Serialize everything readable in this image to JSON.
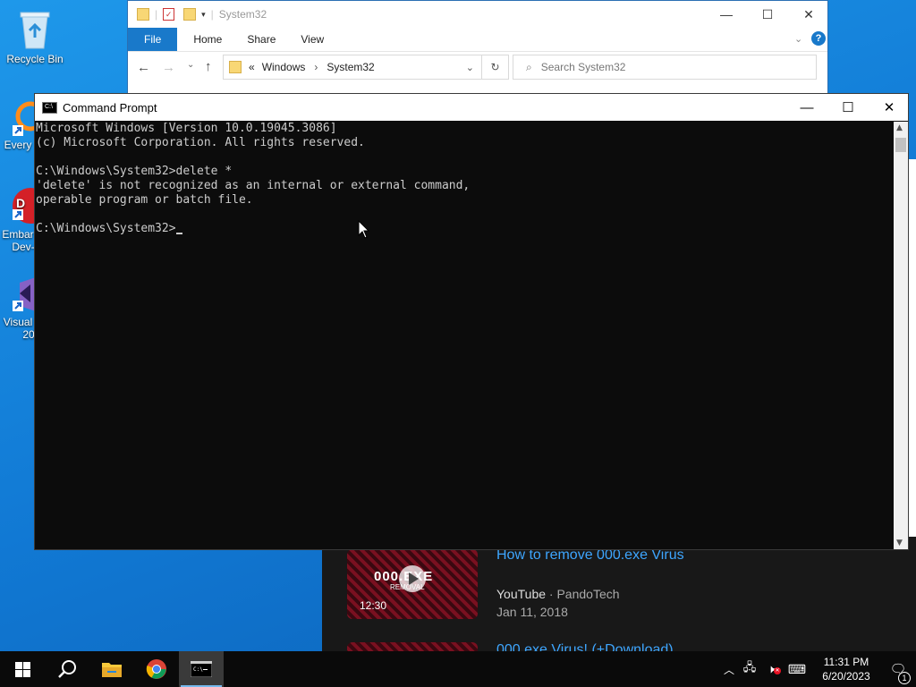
{
  "desktop": {
    "icons": [
      {
        "label": "Recycle Bin"
      },
      {
        "label": "Every"
      },
      {
        "label": "Embar"
      },
      {
        "label": "Dev-"
      },
      {
        "label": "Visual"
      },
      {
        "label": "20"
      }
    ]
  },
  "explorer": {
    "title": "System32",
    "ribbon_tabs": [
      "File",
      "Home",
      "Share",
      "View"
    ],
    "breadcrumb": [
      "Windows",
      "System32"
    ],
    "breadcrumb_prefix": "«",
    "search_placeholder": "Search System32"
  },
  "cmd": {
    "title": "Command Prompt",
    "lines": [
      "Microsoft Windows [Version 10.0.19045.3086]",
      "(c) Microsoft Corporation. All rights reserved.",
      "",
      "C:\\Windows\\System32>delete *",
      "'delete' is not recognized as an internal or external command,",
      "operable program or batch file.",
      "",
      "C:\\Windows\\System32>"
    ]
  },
  "background": {
    "video1": {
      "title": "How to remove 000.exe Virus",
      "channel": "YouTube",
      "author": "PandoTech",
      "date": "Jan 11, 2018",
      "duration": "12:30",
      "thumb_text": "000.EXE",
      "thumb_sub": "REMOVAL"
    },
    "video2": {
      "title": "000.exe Virus! (+Download)"
    }
  },
  "taskbar": {
    "time": "11:31 PM",
    "date": "6/20/2023",
    "notification_count": "1"
  },
  "colors": {
    "accent": "#1979ca",
    "cmd_bg": "#0c0c0c",
    "cmd_text": "#cccccc",
    "link": "#3ea6ff"
  }
}
